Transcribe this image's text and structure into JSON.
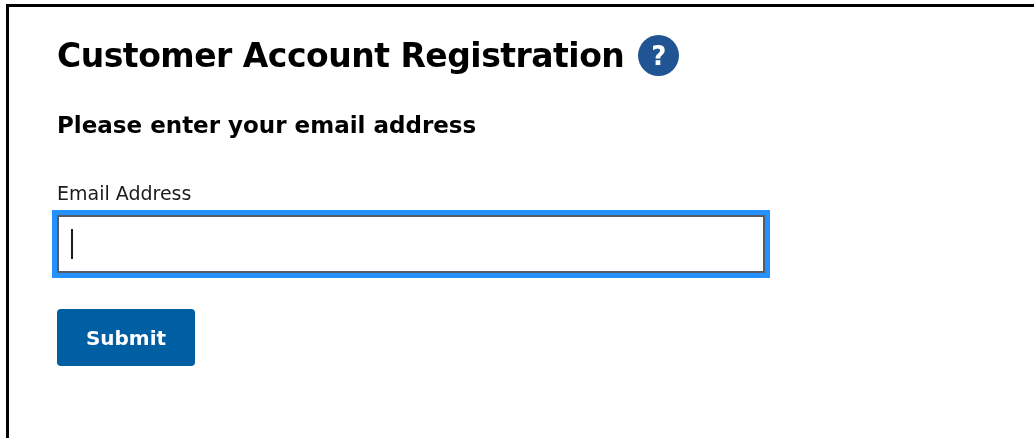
{
  "title": "Customer Account Registration",
  "help": {
    "label": "?"
  },
  "heading": "Please enter your email address",
  "email_field": {
    "label": "Email Address",
    "focused": true
  },
  "submit": {
    "label": "Submit"
  }
}
